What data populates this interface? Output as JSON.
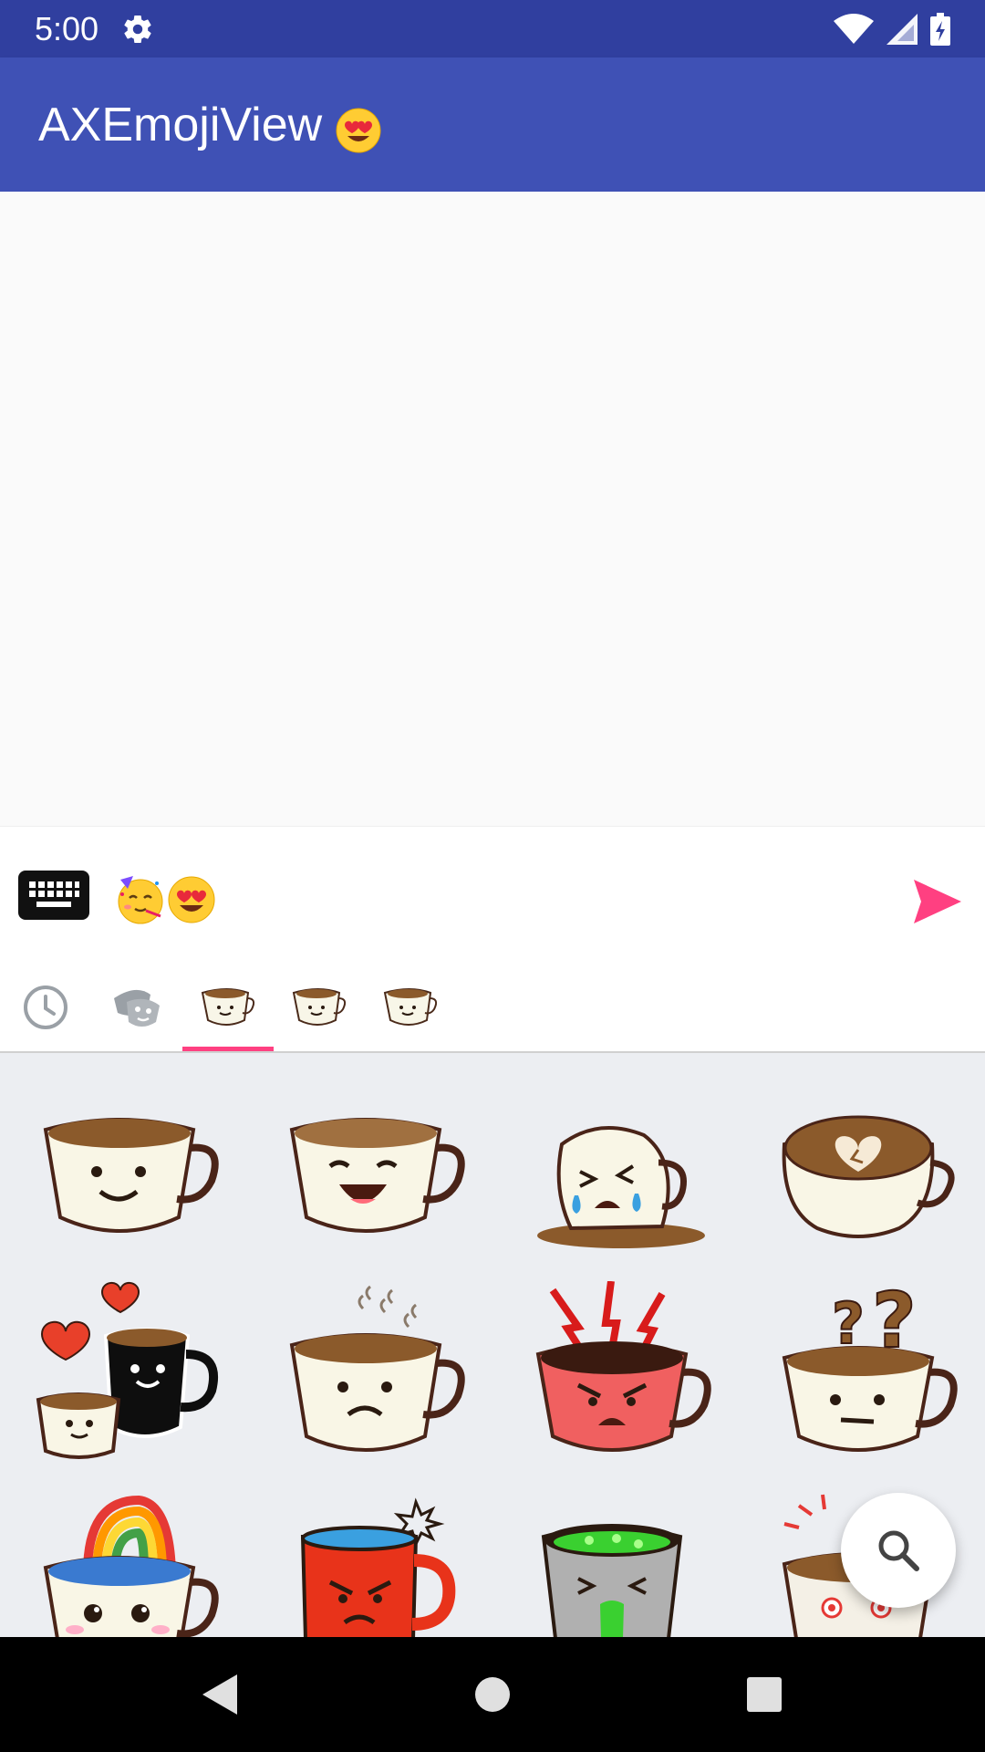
{
  "colors": {
    "status_bar": "#303f9f",
    "app_bar": "#3f51b5",
    "accent": "#ff4081",
    "grid_bg": "#eceef2"
  },
  "status_bar": {
    "time": "5:00",
    "icons": [
      "settings-icon",
      "wifi-icon",
      "cell-signal-icon",
      "battery-icon"
    ]
  },
  "app_bar": {
    "title": "AXEmojiView",
    "title_emoji": "smiling-face-with-heart-eyes"
  },
  "input_bar": {
    "keyboard_icon": "keyboard-icon",
    "entered_emojis": [
      "partying-face",
      "smiling-face-with-heart-eyes"
    ],
    "send_icon": "send-icon"
  },
  "tabs": {
    "items": [
      {
        "name": "recent",
        "icon": "clock-icon"
      },
      {
        "name": "emoji",
        "icon": "mask-icon"
      },
      {
        "name": "coffee-pack-1",
        "icon": "coffee-cup-icon"
      },
      {
        "name": "coffee-pack-2",
        "icon": "coffee-cup-icon"
      },
      {
        "name": "coffee-pack-3",
        "icon": "coffee-cup-icon"
      }
    ],
    "selected_index": 2
  },
  "stickers": [
    {
      "mood": "smiling"
    },
    {
      "mood": "laughing"
    },
    {
      "mood": "crying-spilled"
    },
    {
      "mood": "heart-latte"
    },
    {
      "mood": "love-mugs"
    },
    {
      "mood": "sad-steaming"
    },
    {
      "mood": "angry-red"
    },
    {
      "mood": "confused"
    },
    {
      "mood": "rainbow"
    },
    {
      "mood": "angry-mug"
    },
    {
      "mood": "sick-green"
    },
    {
      "mood": "shocked"
    }
  ],
  "fab": {
    "icon": "search-icon"
  },
  "nav_bar": {
    "icons": [
      "back-icon",
      "home-icon",
      "recents-icon"
    ]
  }
}
